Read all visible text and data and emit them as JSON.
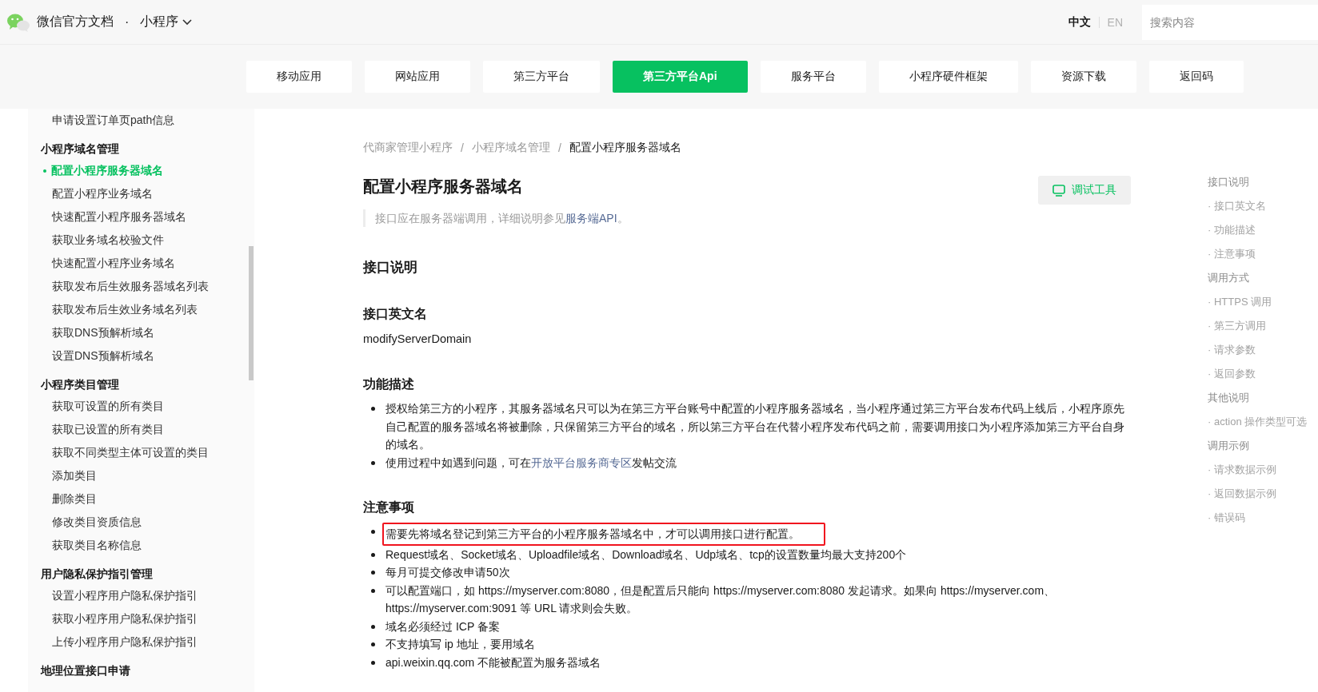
{
  "header": {
    "site_title": "微信官方文档",
    "separator": "·",
    "product": "小程序",
    "languages": [
      {
        "label": "中文",
        "selected": true
      },
      {
        "label": "EN",
        "selected": false
      }
    ],
    "search": {
      "placeholder": "搜索内容"
    }
  },
  "nav_tabs": [
    {
      "label": "移动应用",
      "selected": false
    },
    {
      "label": "网站应用",
      "selected": false
    },
    {
      "label": "第三方平台",
      "selected": false
    },
    {
      "label": "第三方平台Api",
      "selected": true
    },
    {
      "label": "服务平台",
      "selected": false
    },
    {
      "label": "小程序硬件框架",
      "selected": false
    },
    {
      "label": "资源下载",
      "selected": false
    },
    {
      "label": "返回码",
      "selected": false
    }
  ],
  "sidebar": {
    "items": [
      {
        "kind": "link",
        "label": "申请设置订单页path信息",
        "selected": false
      },
      {
        "kind": "heading",
        "label": "小程序域名管理"
      },
      {
        "kind": "link",
        "label": "配置小程序服务器域名",
        "selected": true
      },
      {
        "kind": "link",
        "label": "配置小程序业务域名",
        "selected": false
      },
      {
        "kind": "link",
        "label": "快速配置小程序服务器域名",
        "selected": false
      },
      {
        "kind": "link",
        "label": "获取业务域名校验文件",
        "selected": false
      },
      {
        "kind": "link",
        "label": "快速配置小程序业务域名",
        "selected": false
      },
      {
        "kind": "link",
        "label": "获取发布后生效服务器域名列表",
        "selected": false
      },
      {
        "kind": "link",
        "label": "获取发布后生效业务域名列表",
        "selected": false
      },
      {
        "kind": "link",
        "label": "获取DNS预解析域名",
        "selected": false
      },
      {
        "kind": "link",
        "label": "设置DNS预解析域名",
        "selected": false
      },
      {
        "kind": "heading",
        "label": "小程序类目管理"
      },
      {
        "kind": "link",
        "label": "获取可设置的所有类目",
        "selected": false
      },
      {
        "kind": "link",
        "label": "获取已设置的所有类目",
        "selected": false
      },
      {
        "kind": "link",
        "label": "获取不同类型主体可设置的类目",
        "selected": false
      },
      {
        "kind": "link",
        "label": "添加类目",
        "selected": false
      },
      {
        "kind": "link",
        "label": "删除类目",
        "selected": false
      },
      {
        "kind": "link",
        "label": "修改类目资质信息",
        "selected": false
      },
      {
        "kind": "link",
        "label": "获取类目名称信息",
        "selected": false
      },
      {
        "kind": "heading",
        "label": "用户隐私保护指引管理"
      },
      {
        "kind": "link",
        "label": "设置小程序用户隐私保护指引",
        "selected": false
      },
      {
        "kind": "link",
        "label": "获取小程序用户隐私保护指引",
        "selected": false
      },
      {
        "kind": "link",
        "label": "上传小程序用户隐私保护指引",
        "selected": false
      },
      {
        "kind": "heading",
        "label": "地理位置接口申请"
      }
    ]
  },
  "main": {
    "breadcrumb": [
      {
        "label": "代商家管理小程序",
        "current": false
      },
      {
        "label": "小程序域名管理",
        "current": false
      },
      {
        "label": "配置小程序服务器域名",
        "current": true
      }
    ],
    "breadcrumb_separator": "/",
    "title": "配置小程序服务器域名",
    "debug_button": "调试工具",
    "note": {
      "text": "接口应在服务器端调用，详细说明参见",
      "link": "服务端API",
      "after": "。"
    },
    "sections": [
      {
        "kind": "heading",
        "title": "接口说明"
      },
      {
        "kind": "paragraph",
        "title": "接口英文名",
        "text": "modifyServerDomain"
      },
      {
        "kind": "bullets",
        "title": "功能描述",
        "items": [
          {
            "text": "授权给第三方的小程序，其服务器域名只可以为在第三方平台账号中配置的小程序服务器域名，当小程序通过第三方平台发布代码上线后，小程序原先自己配置的服务器域名将被删除，只保留第三方平台的域名，所以第三方平台在代替小程序发布代码之前，需要调用接口为小程序添加第三方平台自身的域名。",
            "highlighted": false
          },
          {
            "text": "使用过程中如遇到问题，可在",
            "link": "开放平台服务商专区",
            "after": "发帖交流",
            "highlighted": false
          }
        ]
      },
      {
        "kind": "bullets",
        "title": "注意事项",
        "items": [
          {
            "text": "需要先将域名登记到第三方平台的小程序服务器域名中，才可以调用接口进行配置。",
            "highlighted": true
          },
          {
            "text": "Request域名、Socket域名、Uploadfile域名、Download域名、Udp域名、tcp的设置数量均最大支持200个",
            "highlighted": false
          },
          {
            "text": "每月可提交修改申请50次",
            "highlighted": false
          },
          {
            "text": "可以配置端口，如 https://myserver.com:8080，但是配置后只能向 https://myserver.com:8080 发起请求。如果向 https://myserver.com、https://myserver.com:9091 等 URL 请求则会失败。",
            "highlighted": false
          },
          {
            "text": "域名必须经过 ICP 备案",
            "highlighted": false
          },
          {
            "text": "不支持填写 ip 地址，要用域名",
            "highlighted": false
          },
          {
            "text": "api.weixin.qq.com 不能被配置为服务器域名",
            "highlighted": false
          }
        ]
      }
    ]
  },
  "toc": {
    "items": [
      {
        "kind": "section",
        "label": "接口说明"
      },
      {
        "kind": "sub",
        "label": "· 接口英文名"
      },
      {
        "kind": "sub",
        "label": "· 功能描述"
      },
      {
        "kind": "sub",
        "label": "· 注意事项"
      },
      {
        "kind": "section",
        "label": "调用方式"
      },
      {
        "kind": "sub",
        "label": "· HTTPS 调用"
      },
      {
        "kind": "sub",
        "label": "· 第三方调用"
      },
      {
        "kind": "sub",
        "label": "· 请求参数"
      },
      {
        "kind": "sub",
        "label": "· 返回参数"
      },
      {
        "kind": "section",
        "label": "其他说明"
      },
      {
        "kind": "sub",
        "label": "· action 操作类型可选"
      },
      {
        "kind": "section",
        "label": "调用示例"
      },
      {
        "kind": "sub",
        "label": "· 请求数据示例"
      },
      {
        "kind": "sub",
        "label": "· 返回数据示例"
      },
      {
        "kind": "sub",
        "label": "· 错误码"
      }
    ]
  }
}
